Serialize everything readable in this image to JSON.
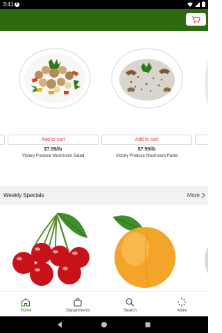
{
  "status_bar": {
    "time": "3:41",
    "badge": "P"
  },
  "colors": {
    "brand_green": "#2e6a0e",
    "cart_red": "#e84040",
    "cherry_red": "#c8121a",
    "apricot": "#f3a52a"
  },
  "header": {
    "icon": "shopping-cart-icon"
  },
  "products": [
    {
      "cart_label": "Add to cart",
      "price": "$7.99/lb",
      "name": "Victory Produce Mushroom Salad",
      "image": "mushroom-salad-image"
    },
    {
      "cart_label": "Add to cart",
      "price": "$7.99/lb",
      "name": "Victory Produce Mushroom Paste",
      "image": "mushroom-paste-image"
    }
  ],
  "specials": {
    "title": "Weekly Specials",
    "more_label": "More",
    "items": [
      "cherries-image",
      "apricot-image"
    ]
  },
  "nav": [
    {
      "label": "Home",
      "icon": "home-icon",
      "active": true
    },
    {
      "label": "Departments",
      "icon": "shopping-bag-icon",
      "active": false
    },
    {
      "label": "Search",
      "icon": "search-icon",
      "active": false
    },
    {
      "label": "More",
      "icon": "more-dots-icon",
      "active": false
    }
  ],
  "system_nav": {
    "back": "back-icon",
    "home": "home-circle-icon",
    "recents": "recents-icon"
  }
}
